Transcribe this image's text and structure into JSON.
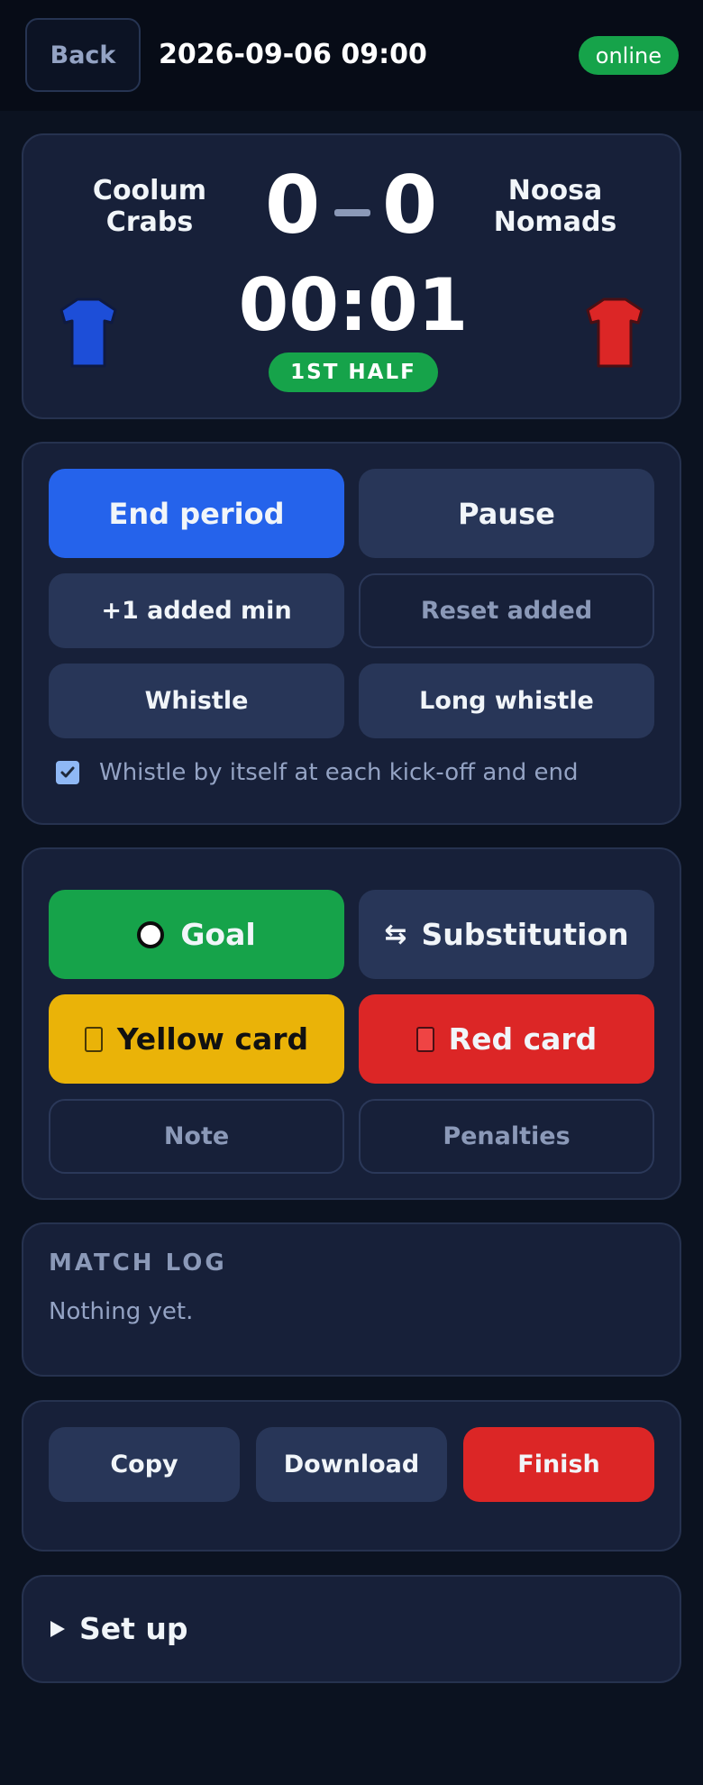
{
  "header": {
    "back_label": "Back",
    "datetime": "2026-09-06 09:00",
    "status": "online"
  },
  "scoreboard": {
    "home_team": "Coolum Crabs",
    "away_team": "Noosa Nomads",
    "home_score": "0",
    "away_score": "0",
    "clock": "00:01",
    "period": "1ST HALF",
    "home_shirt_color": "#1d4ed8",
    "away_shirt_color": "#dc2626"
  },
  "controls": {
    "end_period": "End period",
    "pause": "Pause",
    "add_min": "+1 added min",
    "reset_added": "Reset added",
    "whistle": "Whistle",
    "long_whistle": "Long whistle",
    "auto_whistle_label": "Whistle by itself at each kick-off and end",
    "auto_whistle_checked": true
  },
  "events": {
    "goal": "Goal",
    "substitution": "Substitution",
    "substitution_icon": "⇆",
    "yellow_card": "Yellow card",
    "red_card": "Red card",
    "note": "Note",
    "penalties": "Penalties"
  },
  "match_log": {
    "title": "MATCH LOG",
    "empty": "Nothing yet."
  },
  "actions": {
    "copy": "Copy",
    "download": "Download",
    "finish": "Finish"
  },
  "setup": {
    "label": "Set up"
  },
  "colors": {
    "accent_blue": "#2563eb",
    "green": "#16a34a",
    "yellow": "#eab308",
    "red": "#dc2626",
    "background": "#0b1220",
    "card": "#172039"
  }
}
